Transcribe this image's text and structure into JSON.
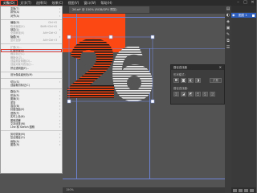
{
  "menubar": {
    "items": [
      {
        "label": "对象(O)",
        "active": true
      },
      {
        "label": "文字(T)"
      },
      {
        "label": "选择(S)"
      },
      {
        "label": "效果(C)"
      },
      {
        "label": "视图(V)"
      },
      {
        "label": "窗口(W)"
      },
      {
        "label": "帮助(H)"
      }
    ],
    "window_controls": [
      "–",
      "□",
      "✕"
    ]
  },
  "document_tab": "26.ai* @ 150% (RGB/GPU 预览)",
  "menu": {
    "rows": [
      {
        "label": "变换(T)",
        "arrow": true
      },
      {
        "label": "排列(A)",
        "arrow": true
      },
      {
        "label": "对齐(A)",
        "arrow": true
      },
      {
        "sep": true
      },
      {
        "label": "编组(G)",
        "shortcut": "Ctrl+G"
      },
      {
        "label": "取消编组(U)",
        "shortcut": "Shift+Ctrl+G",
        "disabled": true
      },
      {
        "label": "锁定(L)",
        "arrow": true
      },
      {
        "label": "全部解锁(K)",
        "shortcut": "Alt+Ctrl+2",
        "disabled": true
      },
      {
        "label": "隐藏(H)",
        "arrow": true
      },
      {
        "label": "显示全部",
        "shortcut": "Alt+Ctrl+3",
        "disabled": true
      },
      {
        "sep": true
      },
      {
        "label": "扩展(X)...",
        "disabled": true
      },
      {
        "label": "扩展外观(E)",
        "highlighted": true
      },
      {
        "label": "裁剪标记(C)",
        "disabled": true
      },
      {
        "label": "栅格化(Z)...",
        "disabled": true
      },
      {
        "label": "创建渐变网格(D)...",
        "disabled": true
      },
      {
        "label": "创建对象马赛克(J)...",
        "disabled": true
      },
      {
        "label": "拼合透明度(F)..."
      },
      {
        "sep": true
      },
      {
        "label": "设为像素级优化(M)"
      },
      {
        "sep": true
      },
      {
        "label": "切片(S)",
        "arrow": true
      },
      {
        "label": "创建裁切标记(C)"
      },
      {
        "sep": true
      },
      {
        "label": "路径(P)",
        "arrow": true
      },
      {
        "label": "形状(P)",
        "arrow": true
      },
      {
        "label": "图案(E)",
        "arrow": true
      },
      {
        "label": "重复",
        "arrow": true
      },
      {
        "label": "混合(B)",
        "arrow": true
      },
      {
        "label": "封套扭曲(V)",
        "arrow": true
      },
      {
        "label": "透视(P)",
        "arrow": true
      },
      {
        "label": "实时上色(N)",
        "arrow": true
      },
      {
        "label": "图像描摹",
        "arrow": true
      },
      {
        "label": "文本绕排(W)",
        "arrow": true
      },
      {
        "label": "Line 和 Sketch 图稿",
        "arrow": true
      },
      {
        "sep": true
      },
      {
        "label": "剪切蒙版(M)",
        "arrow": true
      },
      {
        "label": "复合路径(O)",
        "arrow": true
      },
      {
        "label": "画板(A)",
        "arrow": true
      },
      {
        "label": "图表(R)",
        "arrow": true
      }
    ]
  },
  "pathfinder": {
    "title": "路径查找器",
    "close": "✕",
    "shape_modes_label": "形状模式：",
    "expand_label": "扩展",
    "pathfinders_label": "路径查找器：",
    "shape_buttons": [
      "◘",
      "◙",
      "◧",
      "◨"
    ],
    "path_buttons": [
      "◫",
      "◪",
      "◩",
      "◰",
      "◱",
      "◲"
    ]
  },
  "layers": {
    "row_label": "图层 1",
    "eye": "◉"
  },
  "right_tools": [
    "▤",
    "◐",
    "◈",
    "▣",
    "✎",
    "⧉",
    "☰"
  ],
  "statusbar": "150%",
  "colors": {
    "artboard_orange": "#fc4812",
    "menu_highlight_outline": "#e23a2a",
    "layer_selected": "#2e5fbf"
  }
}
